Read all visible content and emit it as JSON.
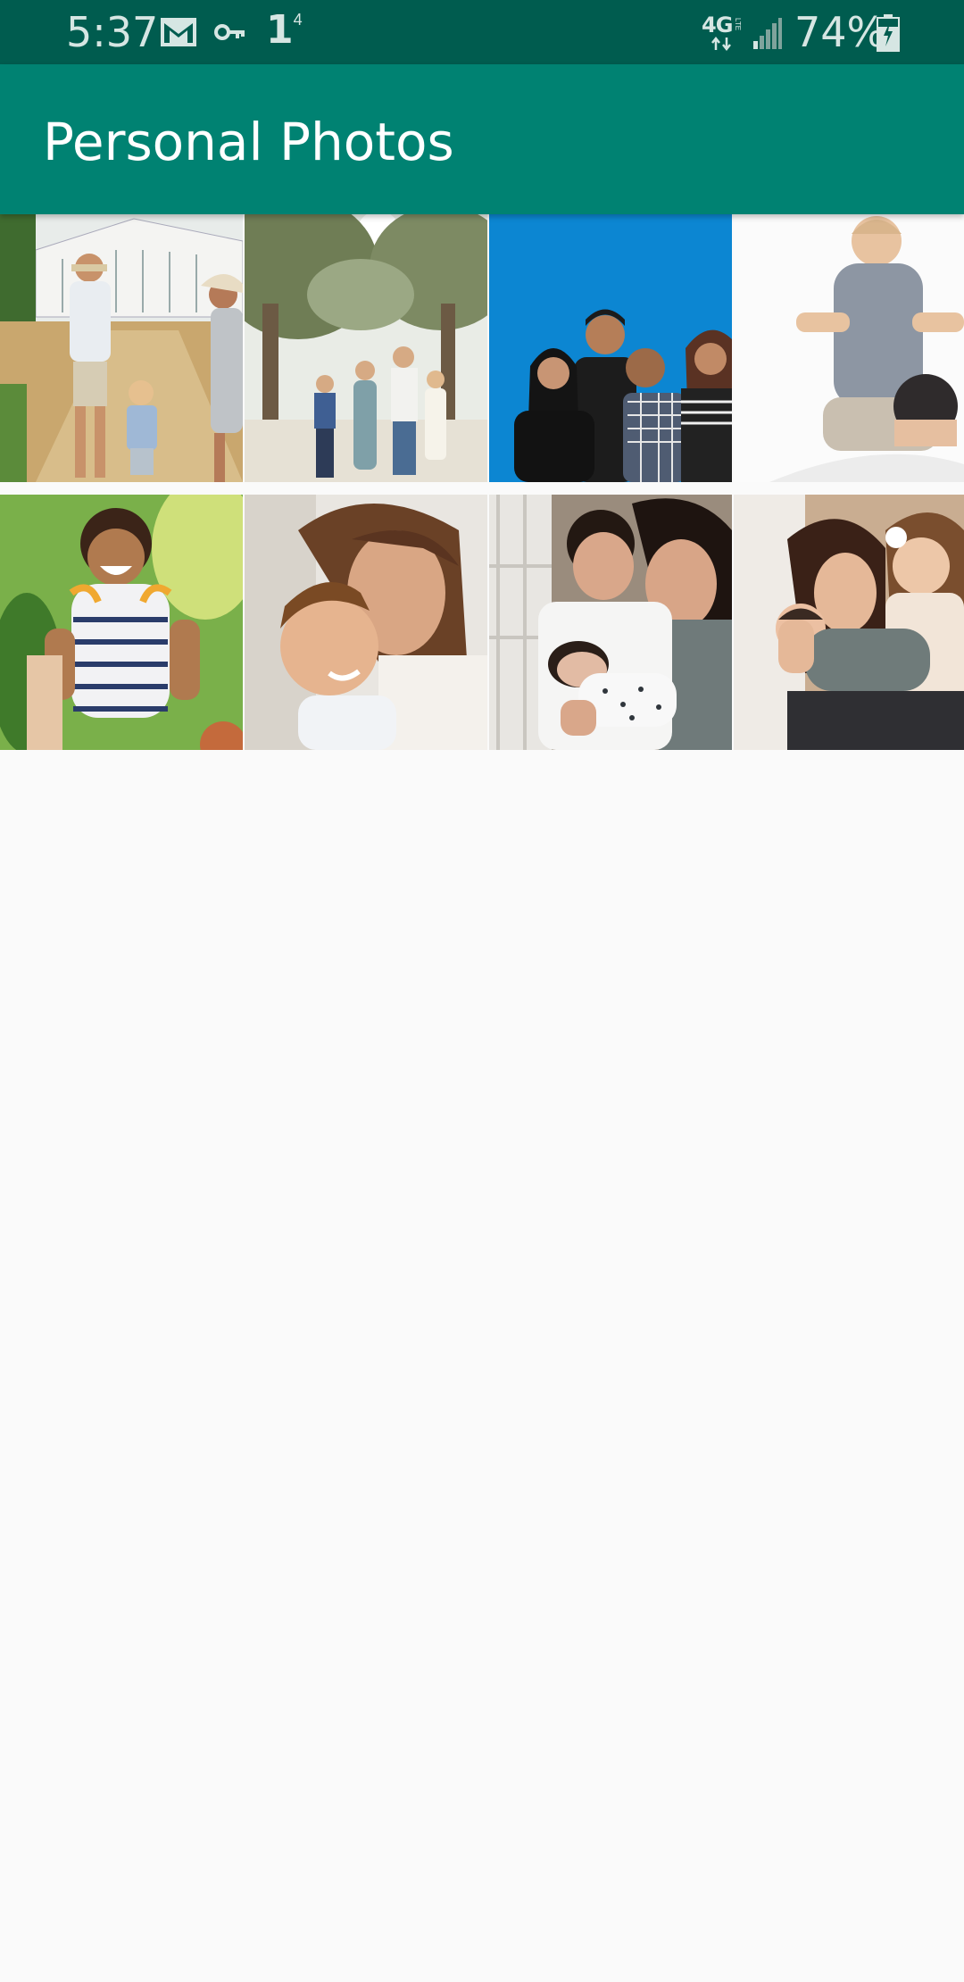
{
  "status_bar": {
    "time": "5:37",
    "notification_badge": "1",
    "notification_superscript": "4",
    "network": "4G",
    "network_sub": "LTE",
    "battery": "74%",
    "icons": [
      "gmail-icon",
      "vpn-key-icon",
      "notification-count-icon",
      "lte-icon",
      "signal-icon",
      "battery-charging-icon"
    ]
  },
  "app_bar": {
    "title": "Personal Photos",
    "color": "#008272",
    "status_color": "#005c4f"
  },
  "photos": [
    {
      "subject": "family walking toward greenhouse"
    },
    {
      "subject": "family of five under trees"
    },
    {
      "subject": "four adults against blue backdrop"
    },
    {
      "subject": "toddler on father's shoulders"
    },
    {
      "subject": "laughing toddler in striped outfit"
    },
    {
      "subject": "mother hugging smiling boy"
    },
    {
      "subject": "parents holding newborn"
    },
    {
      "subject": "mother kissing baby with daughter"
    }
  ]
}
